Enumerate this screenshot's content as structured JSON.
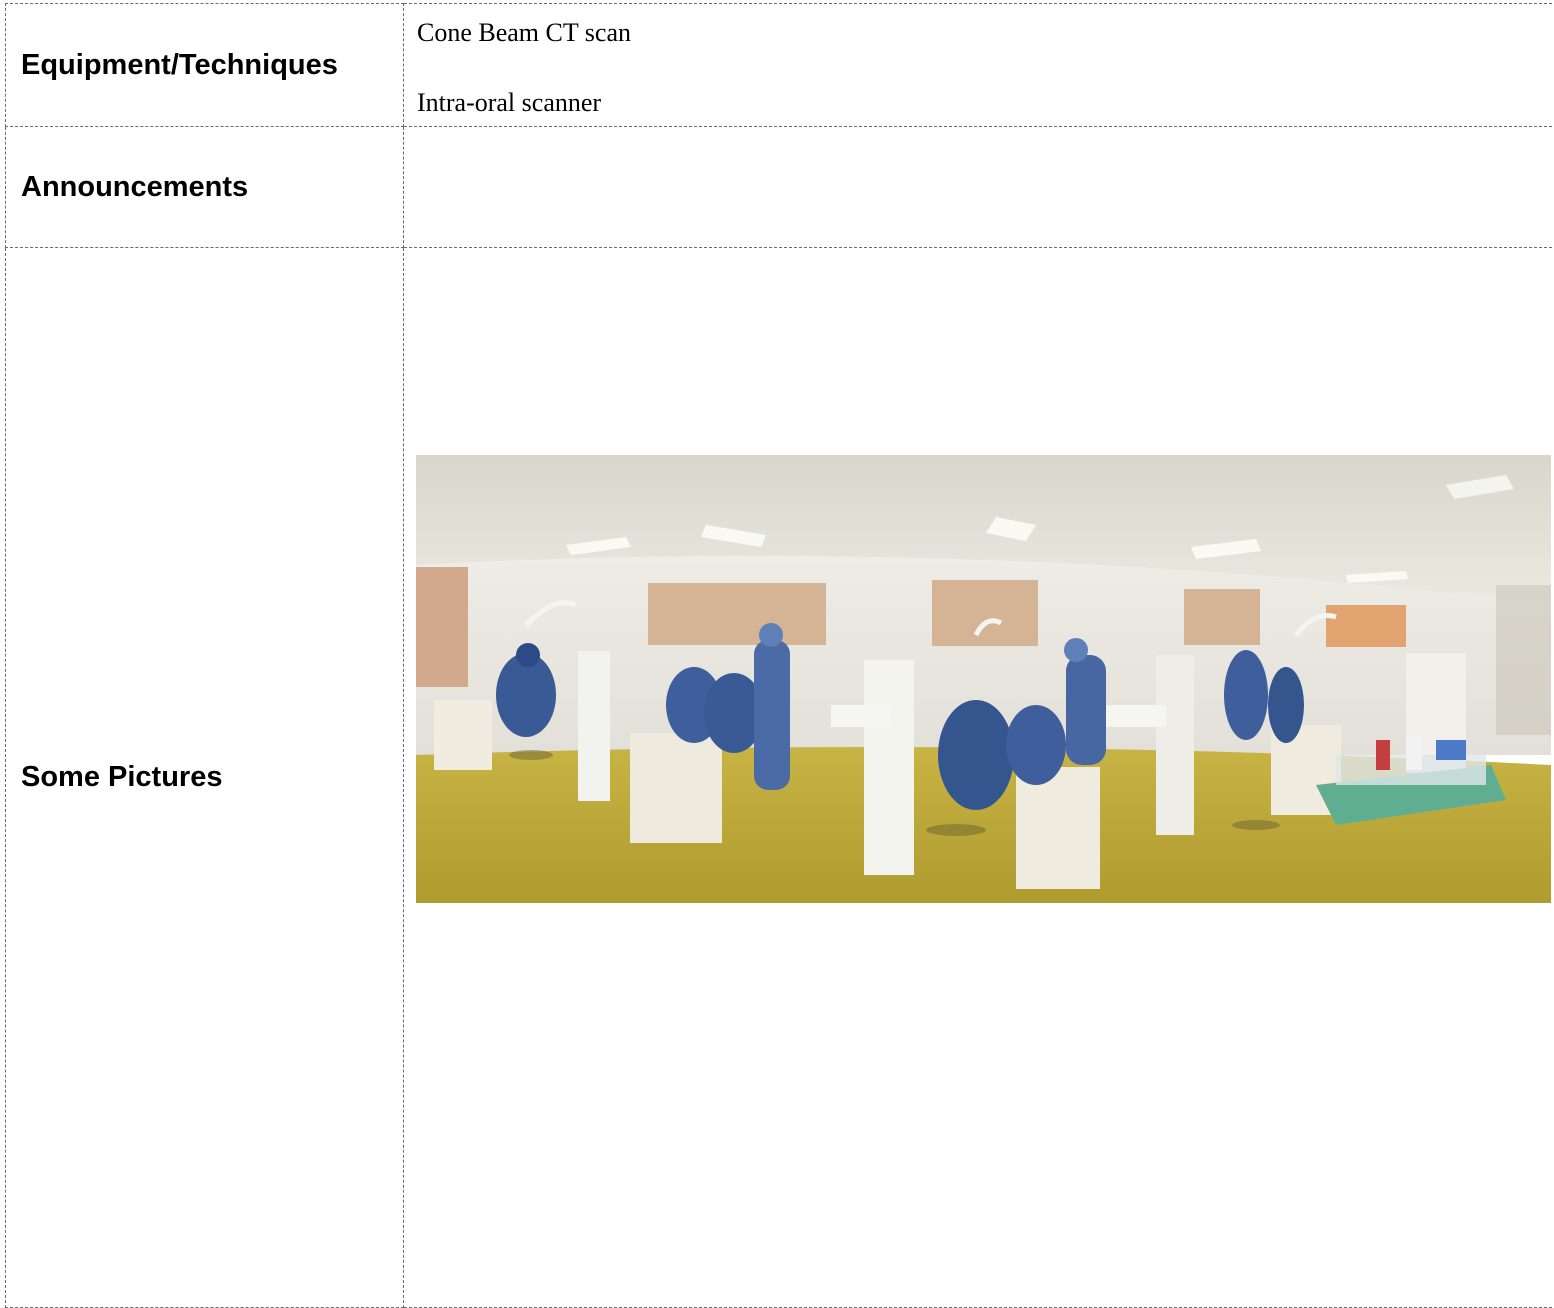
{
  "rows": [
    {
      "label": "Equipment/Techniques",
      "items": [
        "Cone Beam CT scan",
        "Intra-oral scanner"
      ]
    },
    {
      "label": "Announcements",
      "items": []
    },
    {
      "label": "Some Pictures",
      "image_description": "panoramic-photo-dental-clinic"
    }
  ],
  "colors": {
    "border": "#6b6b6b",
    "text": "#000000"
  }
}
